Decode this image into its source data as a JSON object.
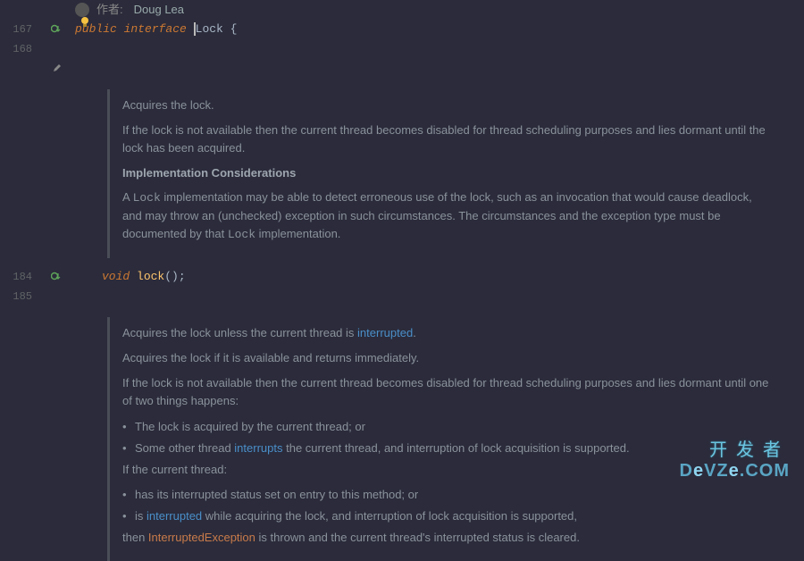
{
  "author_label": "作者:",
  "author_name": "Doug Lea",
  "line_numbers": {
    "l167": "167",
    "l168": "168",
    "l184": "184",
    "l185": "185"
  },
  "code": {
    "public": "public",
    "interface": "interface",
    "classname": "Lock",
    "brace_open": " {",
    "void": "void",
    "method_lock": "lock",
    "lock_suffix": "();"
  },
  "doc1": {
    "p1": "Acquires the lock.",
    "p2": "If the lock is not available then the current thread becomes disabled for thread scheduling purposes and lies dormant until the lock has been acquired.",
    "heading": "Implementation Considerations",
    "p3_a": "A ",
    "p3_code1": "Lock",
    "p3_b": " implementation may be able to detect erroneous use of the lock, such as an invocation that would cause deadlock, and may throw an (unchecked) exception in such circumstances. The circumstances and the exception type must be documented by that ",
    "p3_code2": "Lock",
    "p3_c": " implementation."
  },
  "doc2": {
    "p1_a": "Acquires the lock unless the current thread is ",
    "p1_link": "interrupted",
    "p1_b": ".",
    "p2": "Acquires the lock if it is available and returns immediately.",
    "p3": "If the lock is not available then the current thread becomes disabled for thread scheduling purposes and lies dormant until one of two things happens:",
    "li1": "The lock is acquired by the current thread; or",
    "li2_a": "Some other thread ",
    "li2_link": "interrupts",
    "li2_b": " the current thread, and interruption of lock acquisition is supported.",
    "p4": "If the current thread:",
    "li3": "has its interrupted status set on entry to this method; or",
    "li4_a": "is ",
    "li4_link": "interrupted",
    "li4_b": " while acquiring the lock, and interruption of lock acquisition is supported,",
    "p5_a": "then ",
    "p5_ex": "InterruptedException",
    "p5_b": " is thrown and the current thread's interrupted status is cleared."
  },
  "watermark": {
    "top": "开发者",
    "bot_d": "D",
    "bot_e": "e",
    "bot_vz": "VZ",
    "bot_e2": "e",
    "bot_com": ".COM"
  }
}
